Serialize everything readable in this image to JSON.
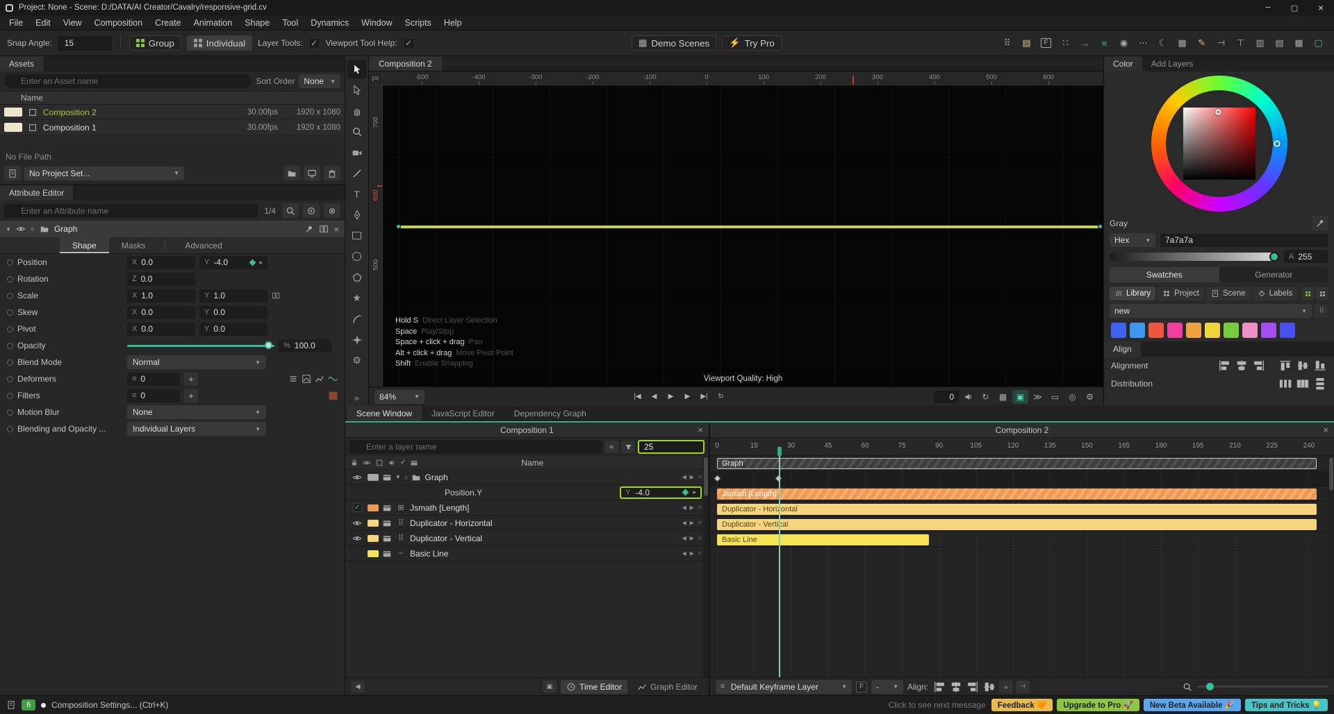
{
  "app": {
    "title": "Project: None - Scene: D:/DATA/AI Creator/Cavalry/responsive-grid.cv"
  },
  "menubar": {
    "items": [
      "File",
      "Edit",
      "View",
      "Composition",
      "Create",
      "Animation",
      "Shape",
      "Tool",
      "Dynamics",
      "Window",
      "Scripts",
      "Help"
    ]
  },
  "toolbar": {
    "snap_angle_label": "Snap Angle:",
    "snap_angle_value": "15",
    "group_label": "Group",
    "individual_label": "Individual",
    "layer_tools_label": "Layer Tools:",
    "viewport_tool_help_label": "Viewport Tool Help:",
    "demo_scenes_label": "Demo Scenes",
    "try_pro_label": "Try Pro",
    "right_icons": [
      {
        "name": "dots-grid",
        "glyph": "⠿"
      },
      {
        "name": "panel-layout",
        "glyph": "▤",
        "tint": "#d9c388"
      },
      {
        "name": "frame-f",
        "glyph": "F",
        "boxed": true
      },
      {
        "name": "dot-matrix",
        "glyph": "∷"
      },
      {
        "name": "export-arrow",
        "glyph": "→",
        "tint": "#3fbf9f"
      },
      {
        "name": "list-green",
        "glyph": "≡",
        "tint": "#3fbf9f"
      },
      {
        "name": "circles-pair",
        "glyph": "◉"
      },
      {
        "name": "overflow-menu",
        "glyph": "⋯"
      },
      {
        "name": "crescent",
        "glyph": "☾"
      },
      {
        "name": "keyboard",
        "glyph": "▦"
      },
      {
        "name": "annotate-pen",
        "glyph": "✎",
        "tint": "#d9c388"
      },
      {
        "name": "align-horizontal",
        "glyph": "⊣"
      },
      {
        "name": "align-vertical",
        "glyph": "⊤"
      },
      {
        "name": "columns-layout",
        "glyph": "▥"
      },
      {
        "name": "rows-layout",
        "glyph": "▤"
      },
      {
        "name": "grid-layout",
        "glyph": "▦"
      },
      {
        "name": "display-toggle",
        "glyph": "▢",
        "tint": "#3fbf9f"
      }
    ]
  },
  "assets": {
    "tab_label": "Assets",
    "search_placeholder": "Enter an Asset name",
    "sort_label": "Sort Order",
    "sort_value": "None",
    "name_header": "Name",
    "items": [
      {
        "name": "Composition 2",
        "fps": "30.00fps",
        "dims": "1920 x 1080",
        "highlight": true
      },
      {
        "name": "Composition 1",
        "fps": "30.00fps",
        "dims": "1920 x 1080",
        "highlight": false
      }
    ],
    "no_file_path": "No File Path",
    "project_value": "No Project Set..."
  },
  "attribute_editor": {
    "tab_label": "Attribute Editor",
    "search_placeholder": "Enter an Attribute name",
    "pager": "1/4",
    "layer_name": "Graph",
    "tabs": [
      {
        "label": "Shape",
        "active": true
      },
      {
        "label": "Masks",
        "active": false
      },
      {
        "label": "Advanced",
        "active": false,
        "separated": true
      }
    ],
    "properties": [
      {
        "label": "Position",
        "type": "fields",
        "fields": [
          {
            "prefix": "X",
            "value": "0.0"
          },
          {
            "prefix": "Y",
            "value": "-4.0",
            "keyed": true
          }
        ]
      },
      {
        "label": "Rotation",
        "type": "fields",
        "fields": [
          {
            "prefix": "Z",
            "value": "0.0"
          }
        ]
      },
      {
        "label": "Scale",
        "type": "fields",
        "fields": [
          {
            "prefix": "X",
            "value": "1.0"
          },
          {
            "prefix": "Y",
            "value": "1.0"
          }
        ],
        "linked": true
      },
      {
        "label": "Skew",
        "type": "fields",
        "fields": [
          {
            "prefix": "X",
            "value": "0.0"
          },
          {
            "prefix": "Y",
            "value": "0.0"
          }
        ]
      },
      {
        "label": "Pivot",
        "type": "fields",
        "fields": [
          {
            "prefix": "X",
            "value": "0.0"
          },
          {
            "prefix": "Y",
            "value": "0.0"
          }
        ]
      },
      {
        "label": "Opacity",
        "type": "slider",
        "prefix": "%",
        "value": "100.0"
      },
      {
        "label": "Blend Mode",
        "type": "select",
        "value": "Normal"
      },
      {
        "label": "Deformers",
        "type": "list-add",
        "value": "0",
        "trailing": [
          "list",
          "curvebox",
          "graphbox",
          "wave"
        ]
      },
      {
        "label": "Filters",
        "type": "list-add",
        "value": "0",
        "trailing": [
          "red-swatch"
        ]
      },
      {
        "label": "Motion Blur",
        "type": "select",
        "value": "None"
      },
      {
        "label": "Blending and Opacity ...",
        "type": "select",
        "value": "Individual Layers"
      }
    ]
  },
  "tools": {
    "items": [
      "select",
      "direct-select",
      "hand",
      "zoom",
      "camera",
      "line",
      "text",
      "pen",
      "rectangle",
      "ellipse",
      "polygon",
      "star",
      "arc",
      "spark",
      "settings"
    ],
    "more_label": "»"
  },
  "viewport": {
    "tab_label": "Composition 2",
    "ruler_unit": "px",
    "h_ticks": [
      "-500",
      "-400",
      "-300",
      "-200",
      "-100",
      "0",
      "100",
      "200",
      "300",
      "400",
      "500",
      "600"
    ],
    "v_ticks": [
      {
        "label": "700",
        "hot": false
      },
      {
        "label": "600",
        "hot": true
      },
      {
        "label": "500",
        "hot": false
      }
    ],
    "hints": [
      {
        "key": "Hold S",
        "desc": "Direct Layer Selection"
      },
      {
        "key": "Space",
        "desc": "Play/Stop"
      },
      {
        "key": "Space + click + drag",
        "desc": "Pan"
      },
      {
        "key": "Alt + click + drag",
        "desc": "Move Pivot Point"
      },
      {
        "key": "Shift",
        "desc": "Enable Snapping"
      }
    ],
    "quality": "Viewport Quality: High",
    "zoom": "84%",
    "counter": "0"
  },
  "color_panel": {
    "tab_color": "Color",
    "tab_add_layers": "Add Layers",
    "gray_label": "Gray",
    "hex_label": "Hex",
    "hex_value": "7a7a7a",
    "alpha_prefix": "A",
    "alpha_value": "255",
    "tab_swatches": "Swatches",
    "tab_generator": "Generator",
    "source_buttons": [
      {
        "label": "Library",
        "icon": "lines3",
        "active": true
      },
      {
        "label": "Project",
        "icon": "grid4s",
        "active": false
      },
      {
        "label": "Scene",
        "icon": "doc",
        "active": false
      },
      {
        "label": "Labels",
        "icon": "tag",
        "active": false
      }
    ],
    "group_value": "new",
    "swatches": [
      "#3e63f0",
      "#3e96f0",
      "#f0573e",
      "#f03e9e",
      "#f0a23e",
      "#f0d43e",
      "#77cc3d",
      "#f08fc3",
      "#a44df0",
      "#4950f0"
    ],
    "align_header": "Align",
    "alignment_label": "Alignment",
    "distribution_label": "Distribution"
  },
  "scene_window": {
    "tabs": [
      {
        "label": "Scene Window",
        "active": true
      },
      {
        "label": "JavaScript Editor",
        "active": false
      },
      {
        "label": "Dependency Graph",
        "active": false
      }
    ],
    "layers": {
      "title": "Composition 1",
      "search_placeholder": "Enter a layer name",
      "frame_field": "25",
      "name_header": "Name",
      "rows": [
        {
          "kind": "group",
          "name": "Graph",
          "swatch": "#a8a8a8",
          "vis": "eye"
        },
        {
          "kind": "prop",
          "name": "Position.Y",
          "prefix": "Y",
          "value": "-4.0"
        },
        {
          "kind": "layer",
          "name": "Jsmath [Length]",
          "swatch": "#ef9a53",
          "vis": "check",
          "glyph": "⊞"
        },
        {
          "kind": "layer",
          "name": "Duplicator - Horizontal",
          "swatch": "#f5d57d",
          "vis": "eye",
          "glyph": "⠿"
        },
        {
          "kind": "layer",
          "name": "Duplicator - Vertical",
          "swatch": "#f5d57d",
          "vis": "eye",
          "glyph": "⠿"
        },
        {
          "kind": "layer",
          "name": "Basic Line",
          "swatch": "#f6e356",
          "vis": "none",
          "glyph": "┄"
        }
      ],
      "time_editor_label": "Time Editor",
      "graph_editor_label": "Graph Editor"
    },
    "timeline": {
      "title": "Composition 2",
      "ticks": [
        "0",
        "15",
        "30",
        "45",
        "60",
        "75",
        "90",
        "105",
        "120",
        "135",
        "150",
        "165",
        "180",
        "195",
        "210",
        "225",
        "240"
      ],
      "playhead_frame": 25,
      "tracks": [
        {
          "label": "Graph",
          "start": 0,
          "end": 243,
          "color": "#3e3e3e",
          "text": "#e6e6e6",
          "hatch": "dark",
          "outline": true
        },
        {
          "keyframes": [
            0,
            25
          ]
        },
        {
          "label": "Jsmath [Length]",
          "start": 0,
          "end": 243,
          "color": "#ef9a53",
          "text": "#ffffff",
          "hatch": "light"
        },
        {
          "label": "Duplicator - Horizontal",
          "start": 0,
          "end": 243,
          "color": "#f5d57d",
          "text": "#5a4510"
        },
        {
          "label": "Duplicator - Vertical",
          "start": 0,
          "end": 243,
          "color": "#f5d57d",
          "text": "#5a4510"
        },
        {
          "label": "Basic Line",
          "start": 0,
          "end": 86,
          "color": "#f6e356",
          "text": "#5a4510"
        }
      ],
      "keyframe_layer_label": "Default Keyframe Layer",
      "f_badge": "F",
      "filter_value": "-",
      "align_label": "Align:"
    }
  },
  "statusbar": {
    "count_badge": "6",
    "message": "Composition Settings... (Ctrl+K)",
    "next_hint": "Click to see next message",
    "buttons": [
      {
        "label": "Feedback 🧡",
        "bg": "#e9bb4d"
      },
      {
        "label": "Upgrade to Pro 🚀",
        "bg": "#8dc63f"
      },
      {
        "label": "New Beta Available 🎉",
        "bg": "#5aa7f0"
      },
      {
        "label": "Tips and Tricks 💡",
        "bg": "#46c4c9"
      }
    ]
  }
}
